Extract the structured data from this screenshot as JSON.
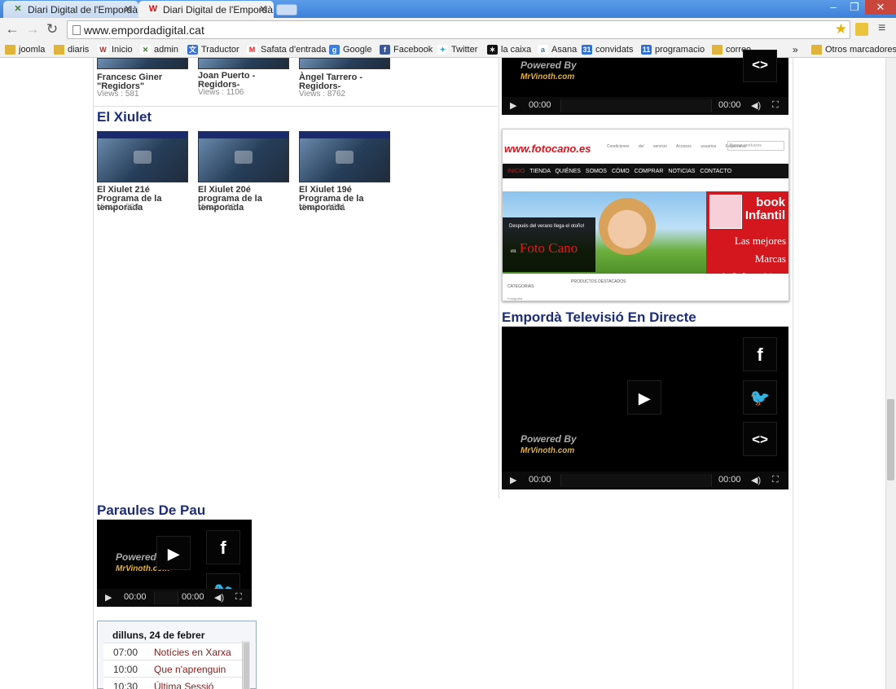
{
  "browser": {
    "tabs": [
      {
        "title": "Diari Digital de l'Empordà",
        "active": false
      },
      {
        "title": "Diari Digital de l'Empordà",
        "active": true
      }
    ],
    "url": "www.empordadigital.cat",
    "bookmarks": [
      {
        "label": "joomla",
        "icon": "folder-icon"
      },
      {
        "label": "diaris",
        "icon": "folder-icon"
      },
      {
        "label": "Inicio",
        "icon": "site-icon"
      },
      {
        "label": "admin",
        "icon": "joomla-icon"
      },
      {
        "label": "Traductor",
        "icon": "translate-icon"
      },
      {
        "label": "Safata d'entrada",
        "icon": "gmail-icon"
      },
      {
        "label": "Google",
        "icon": "google-icon"
      },
      {
        "label": "Facebook",
        "icon": "facebook-icon"
      },
      {
        "label": "Twitter",
        "icon": "twitter-icon"
      },
      {
        "label": "la caixa",
        "icon": "lacaixa-icon"
      },
      {
        "label": "Asana",
        "icon": "asana-icon"
      },
      {
        "label": "convidats",
        "icon": "calendar-icon",
        "badge": "31"
      },
      {
        "label": "programacio",
        "icon": "calendar-icon",
        "badge": "11"
      },
      {
        "label": "correo",
        "icon": "folder-icon"
      }
    ],
    "more": "»",
    "other_bookmarks": "Otros marcadores"
  },
  "top_videos": [
    {
      "title": "Francesc Giner \"Regidors\"",
      "views": "Views : 581"
    },
    {
      "title": "Joan Puerto - Regidors-",
      "views": "Views : 1106"
    },
    {
      "title": "Àngel Tarrero - Regidors-",
      "views": "Views : 8762"
    }
  ],
  "xiulet": {
    "title": "El Xiulet",
    "videos": [
      {
        "title": "El Xiulet 21é Programa de la temporada",
        "views": "Views : 993"
      },
      {
        "title": "El Xiulet 20é programa de la temporada",
        "views": "Views : 18"
      },
      {
        "title": "El Xiulet 19é Programa de la temporada",
        "views": "Views : 1891"
      }
    ]
  },
  "players": {
    "time_current": "00:00",
    "time_total": "00:00",
    "powered_by": "Powered By",
    "powered_brand": "MrVinoth.com"
  },
  "ad": {
    "logo": "www.fotocano.es",
    "toplinks": "Condiciones del servicio   Accesos usuarios   Registrarse",
    "search_placeholder": "Buscar productos",
    "nav": [
      "INICIO",
      "TIENDA",
      "QUIÉNES SOMOS",
      "CÓMO COMPRAR",
      "NOTICIAS",
      "CONTACTO"
    ],
    "slogan": "Después del verano llega el otoño!",
    "en": "en",
    "brand": "Foto Cano",
    "book": "book",
    "infantil": "Infantil",
    "marcas_line1": "Las mejores Marcas",
    "marcas_line2": "de Informáticas",
    "productos": "PRODUCTOS DESTACADOS",
    "categorias": "CATEGORIAS",
    "fotografia": "Fotografía"
  },
  "emporda_tv": {
    "title": "Empordà Televisió En Directe"
  },
  "paraules": {
    "title": "Paraules De Pau",
    "powered_by": "Powered B"
  },
  "schedule": {
    "day": "dilluns, 24 de febrer",
    "rows": [
      {
        "time": "07:00",
        "name": "Notícies en Xarxa"
      },
      {
        "time": "10:00",
        "name": "Que n'aprenguin"
      },
      {
        "time": "10:30",
        "name": "Última Sessió"
      }
    ]
  }
}
